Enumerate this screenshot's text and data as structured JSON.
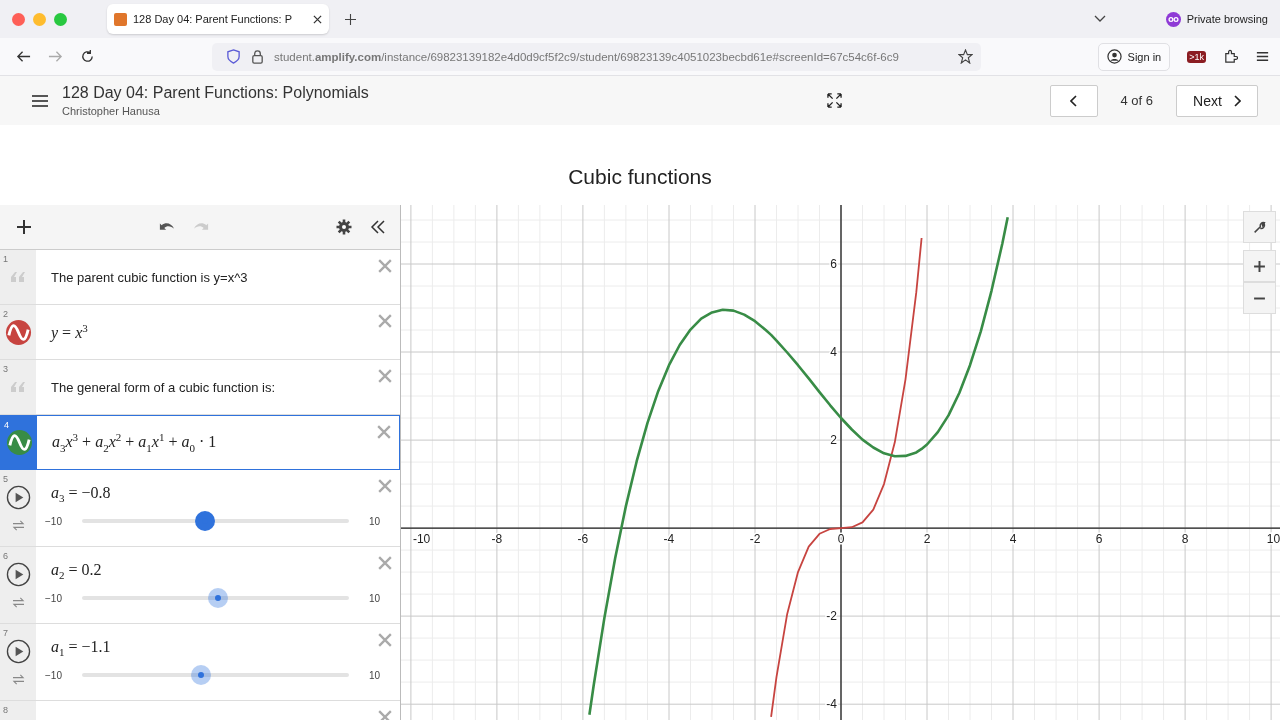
{
  "browser": {
    "tab_title": "128 Day 04: Parent Functions: P",
    "private_label": "Private browsing",
    "url": "student.**amplify.com**/instance/69823139182e4d0d9cf5f2c9/student/69823139c4051023becbd61e#screenId=67c54c6f-6c9",
    "sign_in": "Sign in",
    "extension_badge": ">1k"
  },
  "header": {
    "title": "128 Day 04: Parent Functions: Polynomials",
    "author": "Christopher Hanusa",
    "pager": "4 of 6",
    "next": "Next"
  },
  "screen_title": "Cubic functions",
  "expressions": [
    {
      "number": "1",
      "kind": "note",
      "text": "The parent cubic function is y=x^3",
      "selected": false
    },
    {
      "number": "2",
      "kind": "expression",
      "math": "*y* = *x*$^{3}$",
      "color": "#c74440",
      "selected": false
    },
    {
      "number": "3",
      "kind": "note",
      "text": "The general form of a cubic function is:",
      "selected": false
    },
    {
      "number": "4",
      "kind": "expression",
      "math": "*a*$_{3}$*x*$^{3}$ + *a*$_{2}$*x*$^{2}$ + *a*$_{1}$*x*$^{1}$ + *a*$_{0}$ · 1",
      "color": "#388c46",
      "selected": true
    },
    {
      "number": "5",
      "kind": "slider",
      "math": "*a*$_{3}$ = −0.8",
      "min": "−10",
      "max": "10",
      "level": 0.46,
      "dragging": true,
      "selected": false
    },
    {
      "number": "6",
      "kind": "slider",
      "math": "*a*$_{2}$ = 0.2",
      "min": "−10",
      "max": "10",
      "level": 0.51,
      "dragging": false,
      "selected": false
    },
    {
      "number": "7",
      "kind": "slider",
      "math": "*a*$_{1}$ = −1.1",
      "min": "−10",
      "max": "10",
      "level": 0.445,
      "dragging": false,
      "selected": false
    },
    {
      "number": "8",
      "kind": "cutoff",
      "selected": false
    }
  ],
  "graph": {
    "chart_data": {
      "type": "line",
      "x": [
        -5.85,
        -5.75,
        -5.5,
        -5.25,
        -5,
        -4.75,
        -4.5,
        -4.25,
        -4,
        -3.75,
        -3.5,
        -3.25,
        -3,
        -2.75,
        -2.5,
        -2.25,
        -2,
        -1.75,
        -1.625,
        -1.5,
        -1.25,
        -1,
        -0.75,
        -0.5,
        -0.25,
        0,
        0.25,
        0.5,
        0.75,
        1,
        1.25,
        1.5,
        1.75,
        1.875,
        2,
        2.25,
        2.5,
        2.75,
        3,
        3.25,
        3.5,
        3.75,
        3.875
      ],
      "series": [
        {
          "color": "#c74440",
          "values": [
            null,
            null,
            null,
            null,
            null,
            null,
            null,
            null,
            null,
            null,
            null,
            null,
            null,
            null,
            null,
            null,
            null,
            null,
            -4.29,
            -3.38,
            -1.95,
            -1,
            -0.42,
            -0.13,
            -0.02,
            0,
            0.02,
            0.13,
            0.42,
            1,
            1.95,
            3.38,
            5.36,
            6.59,
            null,
            null,
            null,
            null,
            null,
            null,
            null,
            null,
            null
          ]
        },
        {
          "color": "#388c46",
          "values": [
            -4.24,
            -3.57,
            -2.04,
            -0.68,
            0.5,
            1.52,
            2.39,
            3.11,
            3.7,
            4.16,
            4.51,
            4.76,
            4.9,
            4.96,
            4.94,
            4.85,
            4.7,
            4.5,
            4.39,
            4.26,
            3.99,
            3.7,
            3.4,
            3.09,
            2.79,
            2.5,
            2.24,
            2.01,
            1.83,
            1.7,
            1.63,
            1.64,
            1.72,
            1.8,
            1.9,
            2.18,
            2.56,
            3.07,
            3.7,
            4.47,
            5.39,
            6.46,
            7.06
          ]
        }
      ],
      "grid": true,
      "xlim": [
        -10.23,
        10.23
      ],
      "ylim": [
        -4.36,
        7.34
      ],
      "xticks": [
        -10,
        -8,
        -6,
        -4,
        -2,
        0,
        2,
        4,
        6,
        8,
        10
      ],
      "yticks": [
        -4,
        -2,
        2,
        4,
        6
      ]
    }
  }
}
